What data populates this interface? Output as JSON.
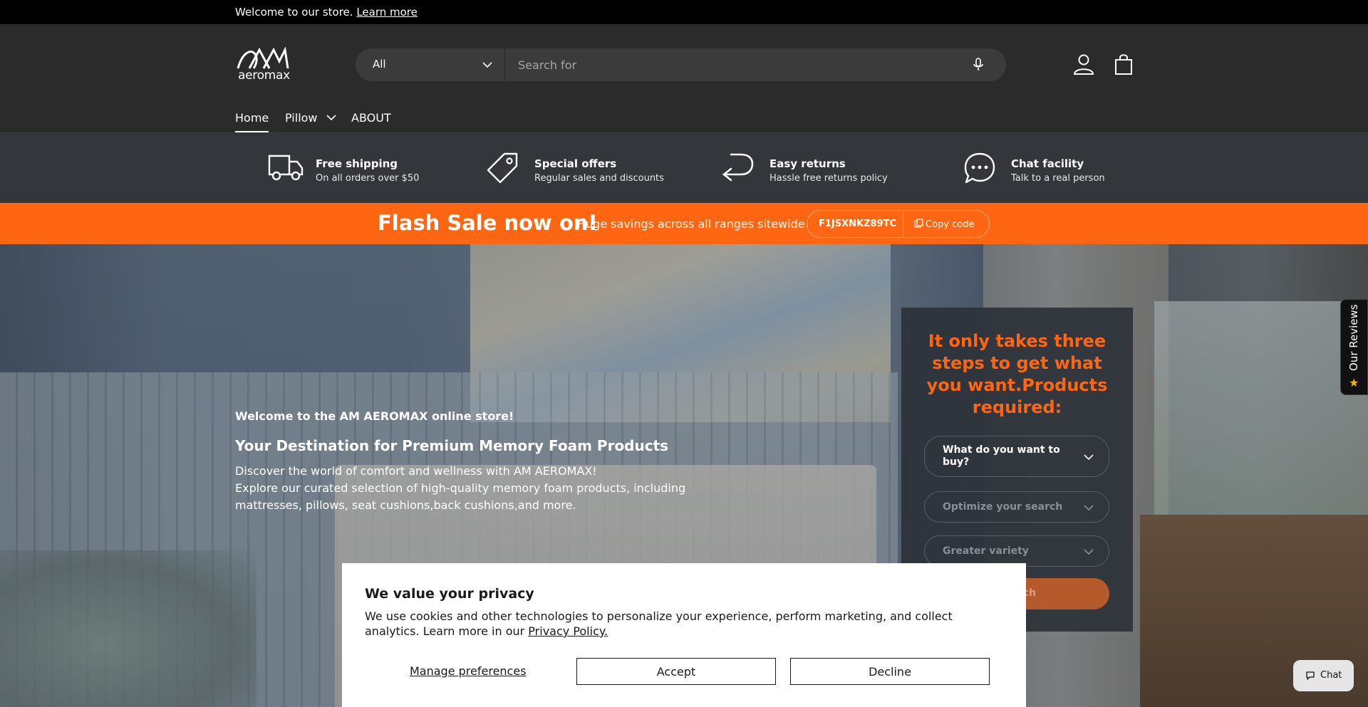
{
  "announcement": {
    "text": "Welcome to our store.",
    "link": "Learn more"
  },
  "header": {
    "logo_text": "aeromax",
    "search": {
      "category": "All",
      "placeholder": "Search for"
    },
    "icons": [
      "account-icon",
      "cart-icon"
    ]
  },
  "nav": {
    "items": [
      {
        "label": "Home",
        "active": true
      },
      {
        "label": "Pillow",
        "has_dropdown": true
      },
      {
        "label": "ABOUT"
      }
    ]
  },
  "features": [
    {
      "icon": "truck-icon",
      "title": "Free shipping",
      "sub": "On all orders over $50"
    },
    {
      "icon": "tag-icon",
      "title": "Special offers",
      "sub": "Regular sales and discounts"
    },
    {
      "icon": "return-arrow-icon",
      "title": "Easy returns",
      "sub": "Hassle free returns policy"
    },
    {
      "icon": "chat-bubble-icon",
      "title": "Chat facility",
      "sub": "Talk to a real person"
    }
  ],
  "flash": {
    "headline": "Flash Sale now on!",
    "subline": "Huge savings across all ranges sitewide",
    "code": "F1JSXNKZ89TC",
    "copy_label": "Copy code",
    "color": "#fe6612"
  },
  "hero": {
    "kicker": "Welcome to the AM AEROMAX online store!",
    "heading": "Your Destination for Premium Memory Foam Products",
    "body_1": "Discover the world of comfort and wellness with AM AEROMAX!",
    "body_2": "Explore our curated selection of high-quality memory foam products, including mattresses, pillows, seat cushions,back cushions,and more."
  },
  "finder": {
    "question": "It only takes three steps to get what you want.Products required:",
    "select_1": "What do you want to buy?",
    "select_2": "Optimize your search",
    "select_3": "Greater variety",
    "button": "Search"
  },
  "cookie": {
    "title": "We value your privacy",
    "desc": "We use cookies and other technologies to personalize your experience, perform marketing, and collect analytics. Learn more in our",
    "policy_link": "Privacy Policy.",
    "manage": "Manage preferences",
    "accept": "Accept",
    "decline": "Decline"
  },
  "reviews_tab": "Our Reviews",
  "chat_label": "Chat"
}
